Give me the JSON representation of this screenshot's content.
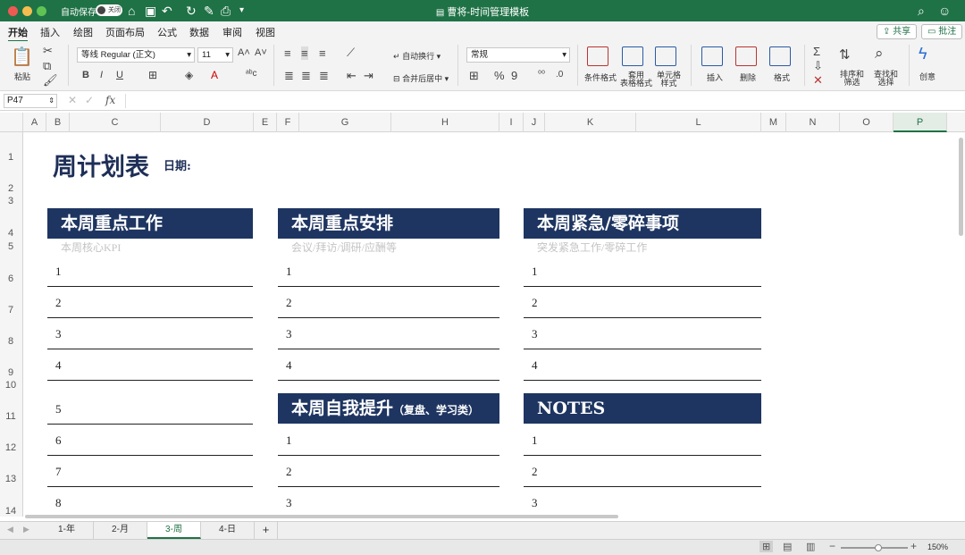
{
  "titlebar": {
    "autosave_label": "自动保存",
    "autosave_state": "关闭",
    "doc_title": "曹将-时间管理模板",
    "colors": {
      "close": "#ee5a52",
      "min": "#f5bd4f",
      "max": "#5fc454"
    }
  },
  "menu_tabs": [
    "开始",
    "插入",
    "绘图",
    "页面布局",
    "公式",
    "数据",
    "审阅",
    "视图"
  ],
  "share": {
    "share_label": "共享",
    "comment_label": "批注"
  },
  "ribbon": {
    "paste_label": "粘贴",
    "font_name": "等线 Regular (正文)",
    "font_size": "11",
    "wrap_label": "自动换行",
    "merge_label": "合并后居中",
    "number_format": "常规",
    "cond_format_label": "条件格式",
    "table_format_label": "套用\n表格格式",
    "cell_style_label": "单元格\n样式",
    "insert_label": "插入",
    "delete_label": "删除",
    "format_label": "格式",
    "sort_label": "排序和\n筛选",
    "find_label": "查找和\n选择",
    "create_label": "创意"
  },
  "formula_bar": {
    "cell_ref": "P47",
    "fx": "fx"
  },
  "columns": [
    "A",
    "B",
    "C",
    "D",
    "E",
    "F",
    "G",
    "H",
    "I",
    "J",
    "K",
    "L",
    "M",
    "N",
    "O",
    "P"
  ],
  "selected_column": "P",
  "rows": [
    "1",
    "2",
    "3",
    "4",
    "5",
    "6",
    "7",
    "8",
    "9",
    "10",
    "11",
    "12",
    "13",
    "14"
  ],
  "sheet": {
    "title": "周计划表",
    "date_label": "日期:",
    "block1": {
      "header": "本周重点工作",
      "sub": "本周核心KPI",
      "items": [
        "1",
        "2",
        "3",
        "4"
      ],
      "items2": [
        "5",
        "6",
        "7",
        "8"
      ]
    },
    "block2": {
      "header": "本周重点安排",
      "sub": "会议/拜访/调研/应酬等",
      "items": [
        "1",
        "2",
        "3",
        "4"
      ]
    },
    "block3": {
      "header": "本周紧急/零碎事项",
      "sub": "突发紧急工作/零碎工作",
      "items": [
        "1",
        "2",
        "3",
        "4"
      ]
    },
    "block4": {
      "header": "本周自我提升",
      "header_small": "（复盘、学习类）",
      "items": [
        "1",
        "2",
        "3"
      ]
    },
    "block5": {
      "header": "NOTES",
      "items": [
        "1",
        "2",
        "3"
      ]
    },
    "header_color": "#1e3561",
    "title_color": "#1e2f57"
  },
  "sheet_tabs": [
    "1-年",
    "2-月",
    "3-周",
    "4-日"
  ],
  "active_sheet": "3-周",
  "add_sheet_label": "+",
  "zoom": "150%",
  "accent_color": "#1f7246"
}
